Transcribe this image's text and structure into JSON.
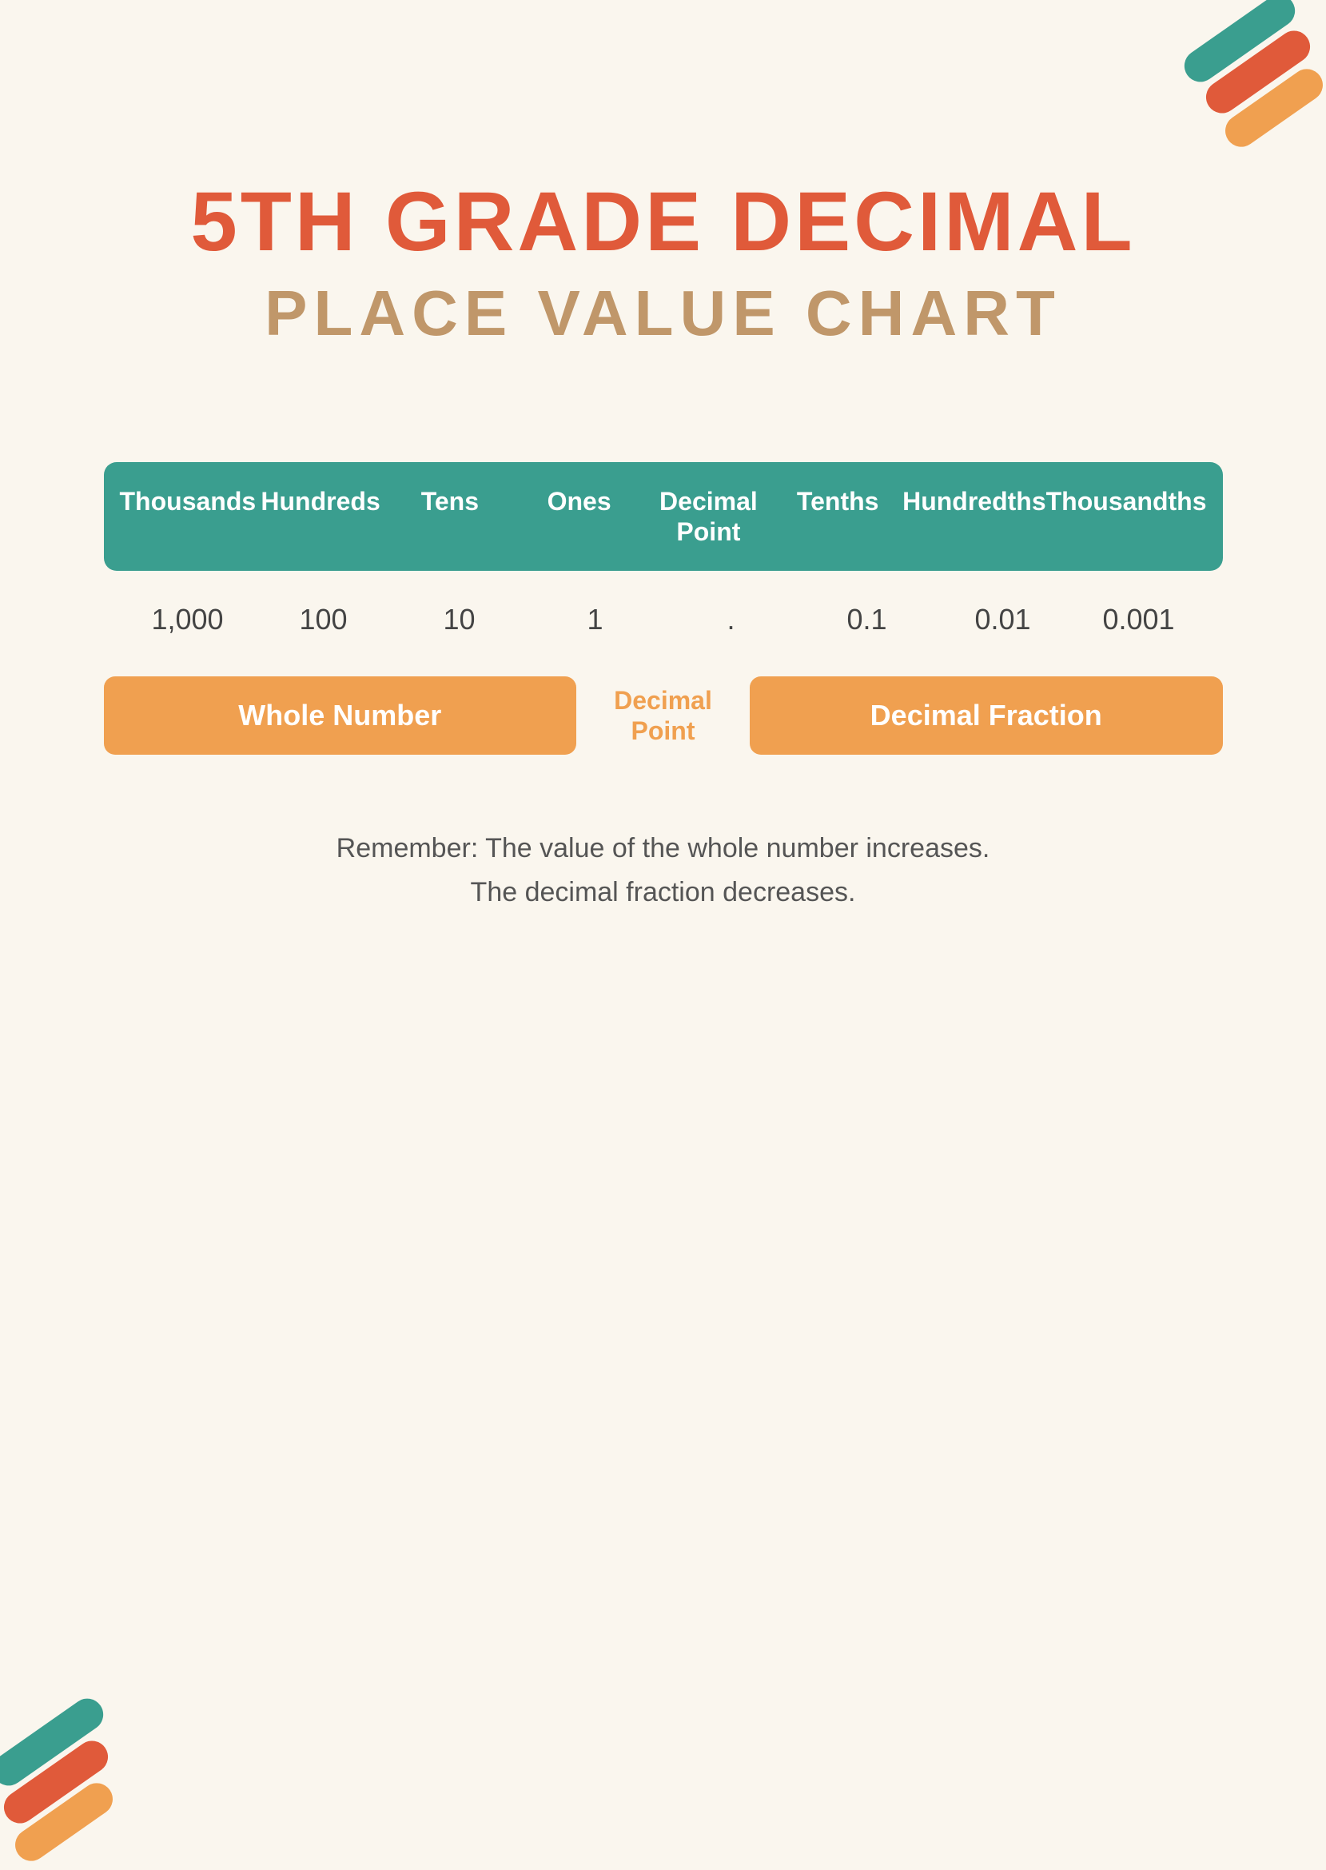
{
  "page": {
    "background_color": "#faf6ee",
    "title_line1": "5TH GRADE DECIMAL",
    "title_line2": "PLACE VALUE CHART"
  },
  "decorations": {
    "top_right": {
      "colors": [
        "#3a9e8f",
        "#e05a3a",
        "#f0a050"
      ]
    },
    "bottom_left": {
      "colors": [
        "#3a9e8f",
        "#e05a3a",
        "#f0a050"
      ]
    }
  },
  "table": {
    "header": {
      "columns": [
        {
          "label": "Thousands"
        },
        {
          "label": "Hundreds"
        },
        {
          "label": "Tens"
        },
        {
          "label": "Ones"
        },
        {
          "label": "Decimal\nPoint"
        },
        {
          "label": "Tenths"
        },
        {
          "label": "Hundredths"
        },
        {
          "label": "Thousandths"
        }
      ]
    },
    "values": [
      {
        "value": "1,000"
      },
      {
        "value": "100"
      },
      {
        "value": "10"
      },
      {
        "value": "1"
      },
      {
        "value": "."
      },
      {
        "value": "0.1"
      },
      {
        "value": "0.01"
      },
      {
        "value": "0.001"
      }
    ],
    "labels": {
      "whole_number": "Whole Number",
      "decimal_point_line1": "Decimal",
      "decimal_point_line2": "Point",
      "decimal_fraction": "Decimal Fraction"
    }
  },
  "remember": {
    "line1": "Remember: The value of the whole number increases.",
    "line2": "The decimal fraction decreases."
  }
}
